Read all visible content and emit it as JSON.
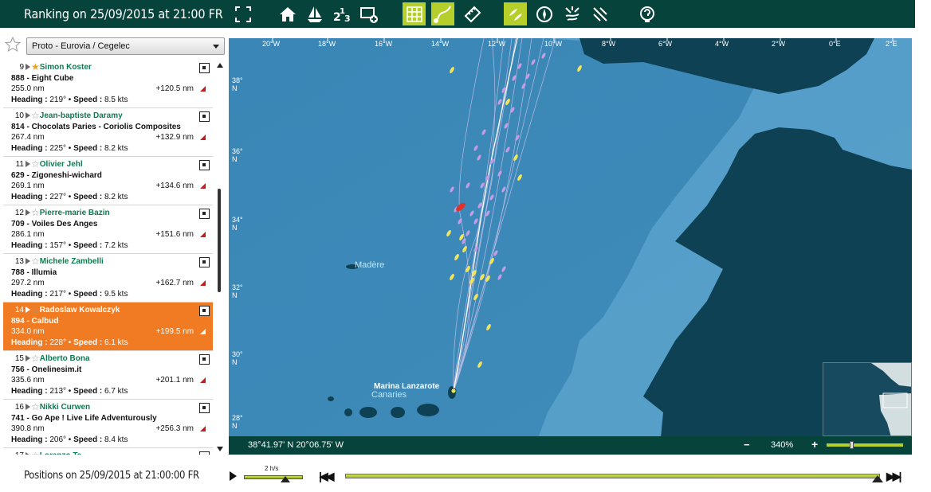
{
  "header": {
    "title": "Ranking on 25/09/2015 at 21:00 FR",
    "toolbar": [
      {
        "icon": "fullscreen-icon",
        "active": false
      },
      {
        "icon": "home-icon",
        "active": false
      },
      {
        "icon": "sailboat-icon",
        "active": false
      },
      {
        "icon": "ranking-123-icon",
        "active": false
      },
      {
        "icon": "add-layer-icon",
        "active": false
      },
      {
        "icon": "grid-icon",
        "active": true
      },
      {
        "icon": "track-icon",
        "active": true
      },
      {
        "icon": "ruler-icon",
        "active": false
      },
      {
        "icon": "boats-icon",
        "active": true
      },
      {
        "icon": "compass-icon",
        "active": false
      },
      {
        "icon": "weather-icon",
        "active": false
      },
      {
        "icon": "wind-icon",
        "active": false
      },
      {
        "icon": "help-icon",
        "active": false
      }
    ]
  },
  "sidebar": {
    "fleet_select": "Proto - Eurovia / Cegelec",
    "ranking": [
      {
        "rank": "9",
        "star": "gold",
        "skipper": "Simon Koster",
        "boat": "888 - Eight Cube",
        "distance": "255.0 nm",
        "gap": "+120.5 nm",
        "heading": "219°",
        "speed": "8.5 kts",
        "selected": false
      },
      {
        "rank": "10",
        "star": "empty",
        "skipper": "Jean-baptiste Daramy",
        "boat": "814 - Chocolats Paries - Coriolis Composites",
        "distance": "267.4 nm",
        "gap": "+132.9 nm",
        "heading": "225°",
        "speed": "8.2 kts",
        "selected": false
      },
      {
        "rank": "11",
        "star": "empty",
        "skipper": "Olivier Jehl",
        "boat": "629 - Zigoneshi-wichard",
        "distance": "269.1 nm",
        "gap": "+134.6 nm",
        "heading": "227°",
        "speed": "8.2 kts",
        "selected": false
      },
      {
        "rank": "12",
        "star": "empty",
        "skipper": "Pierre-marie Bazin",
        "boat": "709 - Voiles Des Anges",
        "distance": "286.1 nm",
        "gap": "+151.6 nm",
        "heading": "157°",
        "speed": "7.2 kts",
        "selected": false
      },
      {
        "rank": "13",
        "star": "empty",
        "skipper": "Michele Zambelli",
        "boat": "788 - Illumia",
        "distance": "297.2 nm",
        "gap": "+162.7 nm",
        "heading": "217°",
        "speed": "9.5 kts",
        "selected": false
      },
      {
        "rank": "14",
        "star": "empty",
        "skipper": "Radoslaw Kowalczyk",
        "boat": "894 - Calbud",
        "distance": "334.0 nm",
        "gap": "+199.5 nm",
        "heading": "228°",
        "speed": "6.1 kts",
        "selected": true
      },
      {
        "rank": "15",
        "star": "empty",
        "skipper": "Alberto Bona",
        "boat": "756 - Onelinesim.it",
        "distance": "335.6 nm",
        "gap": "+201.1 nm",
        "heading": "213°",
        "speed": "6.7 kts",
        "selected": false
      },
      {
        "rank": "16",
        "star": "empty",
        "skipper": "Nikki Curwen",
        "boat": "741 - Go Ape ! Live Life Adventurously",
        "distance": "390.8 nm",
        "gap": "+256.3 nm",
        "heading": "206°",
        "speed": "8.4 kts",
        "selected": false
      },
      {
        "rank": "17",
        "star": "empty",
        "skipper": "Lorenzo Ta",
        "boat": "",
        "distance": "",
        "gap": "",
        "heading": "",
        "speed": "",
        "selected": false
      }
    ],
    "labels": {
      "heading": "Heading : ",
      "speed": "Speed : "
    }
  },
  "map": {
    "longitudes": [
      "20°W",
      "18°W",
      "16°W",
      "14°W",
      "12°W",
      "10°W",
      "8°W",
      "6°W",
      "4°W",
      "2°W",
      "0°E",
      "2°E"
    ],
    "latitudes": [
      "38°",
      "36°",
      "34°",
      "32°",
      "30°",
      "28°"
    ],
    "lat_suffix": "N",
    "labels": {
      "madeira": "Madère",
      "canaries": "Canaries",
      "port": "Marina Lanzarote"
    },
    "cursor_coords": "38°41.97' N 20°06.75' W",
    "zoom_minus": "−",
    "zoom_level": "340%",
    "zoom_plus": "+",
    "colors": {
      "deep_sea": "#2a6f98",
      "sea": "#3f88b6",
      "shelf": "#5aa0cb",
      "land": "#0f4154",
      "boat_purple": "#c79be6",
      "boat_yellow": "#f2e55a",
      "boat_selected": "#e0302a"
    }
  },
  "timebar": {
    "positions_label": "Positions on 25/09/2015 at 21:00:00 FR",
    "speed_label": "2 h/s",
    "rewind": "◀◀",
    "fast_forward": "▶▶"
  }
}
